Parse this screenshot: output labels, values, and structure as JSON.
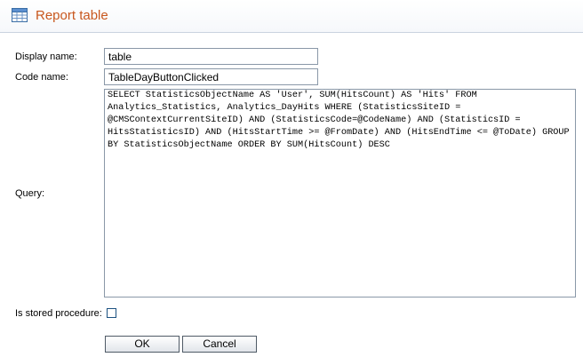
{
  "header": {
    "icon": "table-icon",
    "title": "Report table",
    "title_color": "#c8571d"
  },
  "form": {
    "display_name": {
      "label": "Display name:",
      "value": "table"
    },
    "code_name": {
      "label": "Code name:",
      "value": "TableDayButtonClicked"
    },
    "query": {
      "label": "Query:",
      "value": "SELECT StatisticsObjectName AS 'User', SUM(HitsCount) AS 'Hits' FROM Analytics_Statistics, Analytics_DayHits WHERE (StatisticsSiteID = @CMSContextCurrentSiteID) AND (StatisticsCode=@CodeName) AND (StatisticsID = HitsStatisticsID) AND (HitsStartTime >= @FromDate) AND (HitsEndTime <= @ToDate) GROUP BY StatisticsObjectName ORDER BY SUM(HitsCount) DESC"
    },
    "stored_procedure": {
      "label": "Is stored procedure:",
      "checked": false
    }
  },
  "buttons": {
    "ok_label": "OK",
    "cancel_label": "Cancel"
  }
}
